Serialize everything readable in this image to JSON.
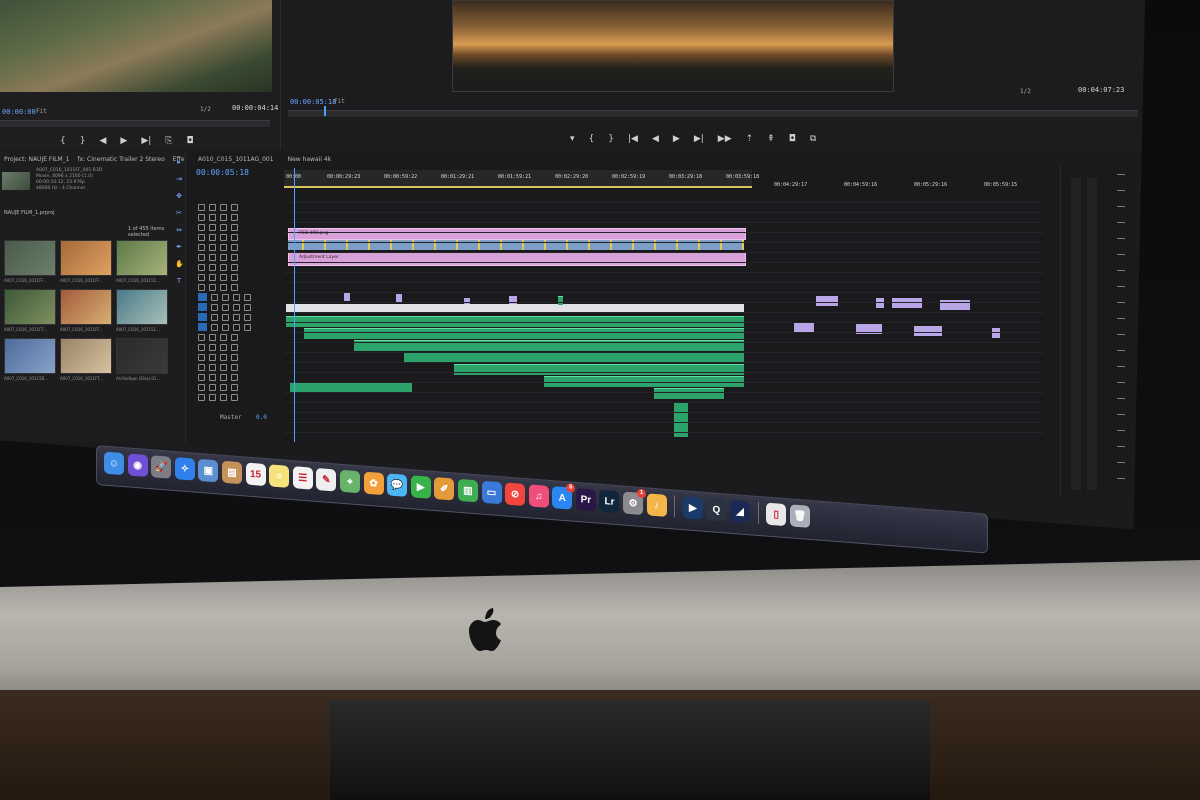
{
  "source_monitor": {
    "timecode_left": "00:00:00",
    "timecode_right": "00:00:04:14",
    "zoom": "Fit",
    "fraction": "1/2"
  },
  "program_monitor": {
    "timecode_left": "00:00:05:18",
    "timecode_right": "00:04:07:23",
    "zoom": "Fit",
    "fraction": "1/2"
  },
  "project_panel": {
    "tabs": [
      "Project: NAUJE FILM_1",
      "fx: Cinematic Trailer 2 Stereo",
      "Effe"
    ],
    "selected_item": "A007_C016_1011FF_001.R3D",
    "meta_lines": [
      "Movie, 4096 x 2160 (1.0)",
      "00:00:10:12, 23.976p",
      "48000 Hz - 4 Channel"
    ],
    "project_name": "NAUJE FILM_1.prproj",
    "item_count": "1 of 455 items selected",
    "thumbnails": [
      {
        "label": "A007_C016_1011FF..."
      },
      {
        "label": "A007_C016_1011FF..."
      },
      {
        "label": "A007_C016_101151..."
      },
      {
        "label": "A007_C016_1011FT..."
      },
      {
        "label": "A007_C016_1011FF..."
      },
      {
        "label": "A007_C016_101151..."
      },
      {
        "label": "A007_C016_10115B..."
      },
      {
        "label": "A007_C016_1011FT..."
      },
      {
        "label": "Archiefopn (Elsa) 01..."
      }
    ]
  },
  "timeline": {
    "tabs": [
      "A010_C015_1011AG_001",
      "New hawaii 4k"
    ],
    "timecode": "00:00:05:18",
    "ruler_ticks": [
      "00:00",
      "00:00:29:23",
      "00:00:59:22",
      "00:01:29:21",
      "00:01:59:21",
      "00:02:29:20",
      "00:02:59:19",
      "00:03:29:18",
      "00:03:59:18"
    ],
    "ruler_ticks_ext": [
      "00:04:29:17",
      "00:04:59:16",
      "00:05:29:16",
      "00:05:59:15"
    ],
    "clip_labels": {
      "pink_top": "PSD 400.png",
      "pink_bottom": "Adjustment Layer"
    },
    "master_label": "Master",
    "master_value": "0.0"
  },
  "dock": {
    "items": [
      {
        "name": "finder",
        "glyph": "☺",
        "color": "#3e8ee8"
      },
      {
        "name": "siri",
        "glyph": "◉",
        "color": "#6f4fd6"
      },
      {
        "name": "launchpad",
        "glyph": "🚀",
        "color": "#7d7d86"
      },
      {
        "name": "safari",
        "glyph": "✧",
        "color": "#2f80ed"
      },
      {
        "name": "preview",
        "glyph": "▣",
        "color": "#5b8fd1"
      },
      {
        "name": "contacts",
        "glyph": "▤",
        "color": "#c5925a"
      },
      {
        "name": "calendar",
        "glyph": "15",
        "color": "#f2f2f2"
      },
      {
        "name": "notes",
        "glyph": "≡",
        "color": "#f6e27a"
      },
      {
        "name": "reminders",
        "glyph": "☰",
        "color": "#f2f2f2"
      },
      {
        "name": "stickies",
        "glyph": "✎",
        "color": "#efefef"
      },
      {
        "name": "maps",
        "glyph": "⌖",
        "color": "#67b36a"
      },
      {
        "name": "photos",
        "glyph": "✿",
        "color": "#f3a03b"
      },
      {
        "name": "messages",
        "glyph": "💬",
        "color": "#4bb6f2"
      },
      {
        "name": "facetime",
        "glyph": "▶",
        "color": "#38b24a"
      },
      {
        "name": "pages",
        "glyph": "✐",
        "color": "#e49a3a"
      },
      {
        "name": "numbers",
        "glyph": "▥",
        "color": "#3fae52"
      },
      {
        "name": "keynote",
        "glyph": "▭",
        "color": "#3b79d8"
      },
      {
        "name": "news",
        "glyph": "⊘",
        "color": "#f3453f"
      },
      {
        "name": "itunes",
        "glyph": "♫",
        "color": "#f04e7a"
      },
      {
        "name": "app-store",
        "glyph": "A",
        "color": "#2a86f0",
        "badge": "6"
      },
      {
        "name": "premiere-pro",
        "glyph": "Pr",
        "color": "#2a1748"
      },
      {
        "name": "lightroom",
        "glyph": "Lr",
        "color": "#10263a"
      },
      {
        "name": "system-preferences",
        "glyph": "⚙",
        "color": "#8a8a8f",
        "badge": "1"
      },
      {
        "name": "folder-music",
        "glyph": "♪",
        "color": "#f2b64a"
      }
    ],
    "items_right": [
      {
        "name": "infuse",
        "glyph": "▶",
        "color": "#1a3b6a"
      },
      {
        "name": "quicktime",
        "glyph": "Q",
        "color": "#2b3240"
      },
      {
        "name": "media-encoder",
        "glyph": "◢",
        "color": "#1a2a55"
      }
    ],
    "items_far": [
      {
        "name": "document",
        "glyph": "▯",
        "color": "#e8e8e8"
      },
      {
        "name": "trash",
        "glyph": "🗑",
        "color": "#a9b0b8"
      }
    ]
  }
}
